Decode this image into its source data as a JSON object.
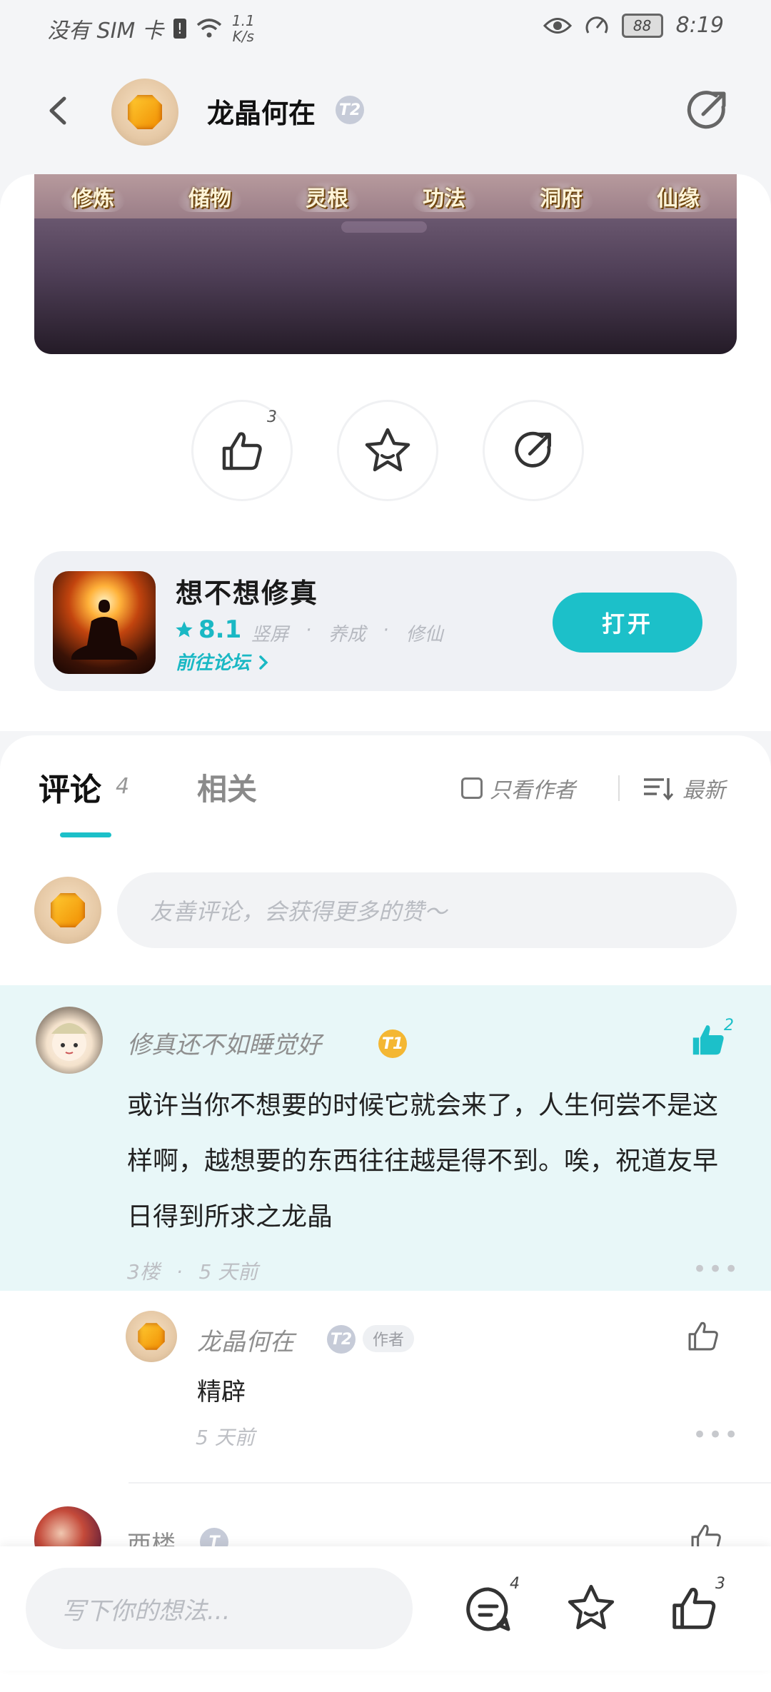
{
  "status_bar": {
    "carrier": "没有 SIM 卡",
    "speed_value": "1.1",
    "speed_unit": "K/s",
    "battery": "88",
    "time": "8:19"
  },
  "header": {
    "author_name": "龙晶何在",
    "author_level": "T2"
  },
  "banner": {
    "tabs": [
      "修炼",
      "储物",
      "灵根",
      "功法",
      "洞府",
      "仙缘"
    ]
  },
  "actions": {
    "like_count": "3"
  },
  "game": {
    "title": "想不想修真",
    "rating": "8.1",
    "tags": [
      "竖屏",
      "·",
      "养成",
      "·",
      "修仙"
    ],
    "forum_link": "前往论坛",
    "open_label": "打开"
  },
  "comments_tabs": {
    "comments_label": "评论",
    "comments_count": "4",
    "related_label": "相关",
    "author_only_label": "只看作者",
    "sort_label": "最新"
  },
  "comment_input": {
    "placeholder": "友善评论，会获得更多的赞～"
  },
  "comments": [
    {
      "user": "修真还不如睡觉好",
      "level": "T1",
      "text": "或许当你不想要的时候它就会来了，人生何尝不是这样啊，越想要的东西往往越是得不到。唉，祝道友早日得到所求之龙晶",
      "floor": "3楼",
      "time": "5 天前",
      "likes": "2",
      "reply": {
        "user": "龙晶何在",
        "level": "T2",
        "author_tag": "作者",
        "text": "精辟",
        "time": "5 天前"
      }
    },
    {
      "user": "西楼",
      "level": "T"
    }
  ],
  "bottom_bar": {
    "placeholder": "写下你的想法...",
    "comment_count": "4",
    "like_count": "3"
  },
  "colors": {
    "accent": "#1cc0c9",
    "highlight_bg": "#e8f7f8"
  }
}
